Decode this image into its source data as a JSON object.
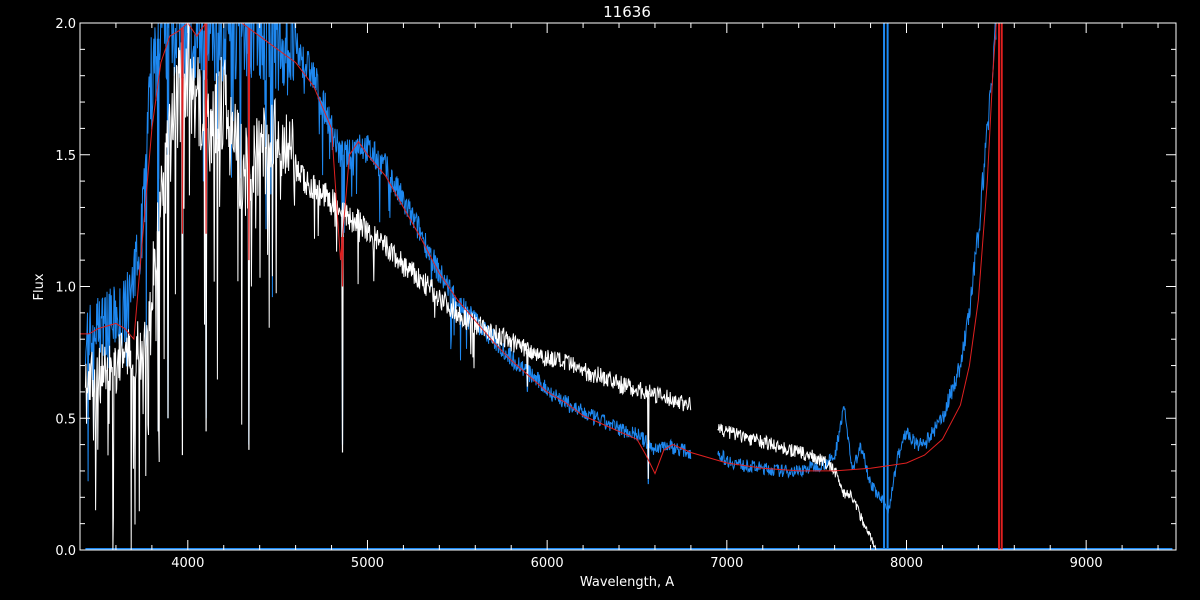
{
  "chart_data": {
    "type": "line",
    "title": "11636",
    "xlabel": "Wavelength, A",
    "ylabel": "Flux",
    "xlim": [
      3400,
      9500
    ],
    "ylim": [
      0,
      2.0
    ],
    "xticks": [
      4000,
      5000,
      6000,
      7000,
      8000,
      9000
    ],
    "xtick_labels": [
      "4000",
      "5000",
      "6000",
      "7000",
      "8000",
      "9000"
    ],
    "yticks": [
      0,
      0.5,
      1.0,
      1.5,
      2.0
    ],
    "ytick_labels": [
      "0.0",
      "0.5",
      "1.0",
      "1.5",
      "2.0"
    ],
    "grid": false,
    "background": "#000000",
    "axis_color": "#ffffff",
    "series": [
      {
        "color": "#ffffff",
        "style": "noisy-spectrum",
        "segments": [
          {
            "x": [
              3430,
              3500,
              3600,
              3700,
              3750,
              3800,
              3850,
              3900,
              3950,
              4000,
              4050,
              4100,
              4150,
              4200,
              4250,
              4300,
              4350,
              4400,
              4450,
              4500,
              4550,
              4600,
              4650,
              4700,
              4750,
              4800,
              4850,
              4900,
              4950,
              5000,
              5100,
              5200,
              5300,
              5400,
              5500,
              5600,
              5700,
              5800,
              5900,
              6000,
              6100,
              6200,
              6300,
              6400,
              6500,
              6550,
              6600,
              6650,
              6700,
              6800
            ],
            "y": [
              0.65,
              0.67,
              0.7,
              0.75,
              0.8,
              1.0,
              1.3,
              1.55,
              1.75,
              1.85,
              1.75,
              1.6,
              1.62,
              1.7,
              1.55,
              1.45,
              1.42,
              1.5,
              1.55,
              1.52,
              1.48,
              1.45,
              1.4,
              1.38,
              1.35,
              1.32,
              1.3,
              1.25,
              1.25,
              1.2,
              1.15,
              1.08,
              1.02,
              0.96,
              0.9,
              0.86,
              0.82,
              0.79,
              0.76,
              0.73,
              0.71,
              0.68,
              0.66,
              0.63,
              0.61,
              0.6,
              0.59,
              0.58,
              0.57,
              0.55
            ]
          },
          {
            "x": [
              6950,
              7000,
              7100,
              7200,
              7300,
              7400,
              7500,
              7550,
              7600,
              7650,
              7700,
              7750,
              7800,
              7830
            ],
            "y": [
              0.46,
              0.45,
              0.43,
              0.41,
              0.39,
              0.37,
              0.35,
              0.33,
              0.3,
              0.22,
              0.2,
              0.12,
              0.05,
              0.0
            ]
          }
        ],
        "dips": [
          {
            "x": 3835,
            "y": 0.45
          },
          {
            "x": 3890,
            "y": 0.5
          },
          {
            "x": 3970,
            "y": 0.36
          },
          {
            "x": 4102,
            "y": 0.45
          },
          {
            "x": 4340,
            "y": 0.38
          },
          {
            "x": 4861,
            "y": 0.37
          },
          {
            "x": 5890,
            "y": 0.62
          },
          {
            "x": 6563,
            "y": 0.27
          }
        ]
      },
      {
        "color": "#1e88f0",
        "style": "noisy-spectrum",
        "segments": [
          {
            "x": [
              3430,
              3500,
              3600,
              3650,
              3700,
              3750,
              3800,
              3850,
              3900,
              4000,
              4100,
              4200,
              4300,
              4400,
              4500,
              4600,
              4700,
              4800,
              4850,
              4900,
              4950,
              5000,
              5100,
              5200,
              5300,
              5400,
              5500,
              5600,
              5700,
              5800,
              5900,
              6000,
              6100,
              6200,
              6300,
              6400,
              6500,
              6550,
              6600,
              6650,
              6700,
              6800
            ],
            "y": [
              0.82,
              0.85,
              0.88,
              0.9,
              1.0,
              1.3,
              1.8,
              2.0,
              2.0,
              2.0,
              2.0,
              2.0,
              2.0,
              2.0,
              1.95,
              1.9,
              1.8,
              1.6,
              1.5,
              1.5,
              1.55,
              1.52,
              1.45,
              1.32,
              1.2,
              1.05,
              0.95,
              0.87,
              0.8,
              0.73,
              0.67,
              0.61,
              0.56,
              0.52,
              0.49,
              0.46,
              0.44,
              0.41,
              0.38,
              0.4,
              0.39,
              0.37
            ]
          },
          {
            "x": [
              6950,
              7000,
              7100,
              7200,
              7300,
              7400,
              7500,
              7550,
              7600,
              7650,
              7700,
              7750,
              7800,
              7850,
              7900,
              7950,
              8000,
              8050,
              8100,
              8150,
              8200,
              8250,
              8300,
              8350,
              8400,
              8450,
              8500
            ],
            "y": [
              0.37,
              0.34,
              0.32,
              0.31,
              0.3,
              0.3,
              0.32,
              0.33,
              0.35,
              0.55,
              0.3,
              0.4,
              0.25,
              0.2,
              0.15,
              0.35,
              0.45,
              0.4,
              0.4,
              0.45,
              0.5,
              0.6,
              0.7,
              0.9,
              1.2,
              1.6,
              2.0
            ]
          }
        ],
        "spikes": [
          {
            "x": 7875,
            "y_from": 0.0,
            "y_to": 2.0
          },
          {
            "x": 7895,
            "y_from": 0.0,
            "y_to": 2.0
          }
        ],
        "floor": {
          "x": [
            3430,
            9480
          ],
          "y": 0.0
        },
        "dips": [
          {
            "x": 3835,
            "y": 0.45
          },
          {
            "x": 3890,
            "y": 0.5
          },
          {
            "x": 3970,
            "y": 0.5
          },
          {
            "x": 4102,
            "y": 0.5
          },
          {
            "x": 4340,
            "y": 0.4
          },
          {
            "x": 4861,
            "y": 0.4
          },
          {
            "x": 5890,
            "y": 0.6
          },
          {
            "x": 6563,
            "y": 0.25
          }
        ]
      },
      {
        "color": "#e02020",
        "style": "smooth",
        "segments": [
          {
            "x": [
              3400,
              3450,
              3500,
              3550,
              3600,
              3650,
              3700,
              3750,
              3800,
              3850,
              3900,
              3950,
              4000,
              4050,
              4100,
              4150,
              4200,
              4300,
              4400,
              4500,
              4600,
              4700,
              4800,
              4850,
              4900,
              4950,
              5000,
              5100,
              5200,
              5300,
              5400,
              5500,
              5600,
              5700,
              5800,
              5900,
              6000,
              6100,
              6200,
              6300,
              6400,
              6500,
              6550,
              6600,
              6650,
              6700,
              6800,
              7000,
              7200,
              7400,
              7600,
              7800,
              8000,
              8100,
              8200,
              8300,
              8350,
              8400,
              8450,
              8480,
              8500
            ],
            "y": [
              0.82,
              0.82,
              0.84,
              0.85,
              0.86,
              0.84,
              0.8,
              1.2,
              1.6,
              1.85,
              1.95,
              1.97,
              2.0,
              1.95,
              2.0,
              2.0,
              2.0,
              2.0,
              1.95,
              1.9,
              1.85,
              1.76,
              1.6,
              1.1,
              1.5,
              1.55,
              1.5,
              1.42,
              1.3,
              1.18,
              1.05,
              0.95,
              0.87,
              0.79,
              0.72,
              0.66,
              0.6,
              0.56,
              0.51,
              0.48,
              0.45,
              0.42,
              0.36,
              0.29,
              0.38,
              0.4,
              0.37,
              0.33,
              0.31,
              0.3,
              0.3,
              0.31,
              0.33,
              0.36,
              0.42,
              0.55,
              0.7,
              0.95,
              1.4,
              1.8,
              2.0
            ]
          }
        ],
        "spikes": [
          {
            "x": 8515,
            "y_from": 0.0,
            "y_to": 2.0
          },
          {
            "x": 8530,
            "y_from": 0.0,
            "y_to": 2.0
          }
        ],
        "dips": [
          {
            "x": 3970,
            "y": 1.2
          },
          {
            "x": 4102,
            "y": 1.2
          },
          {
            "x": 4340,
            "y": 1.1
          },
          {
            "x": 4861,
            "y": 1.0
          }
        ]
      }
    ]
  }
}
